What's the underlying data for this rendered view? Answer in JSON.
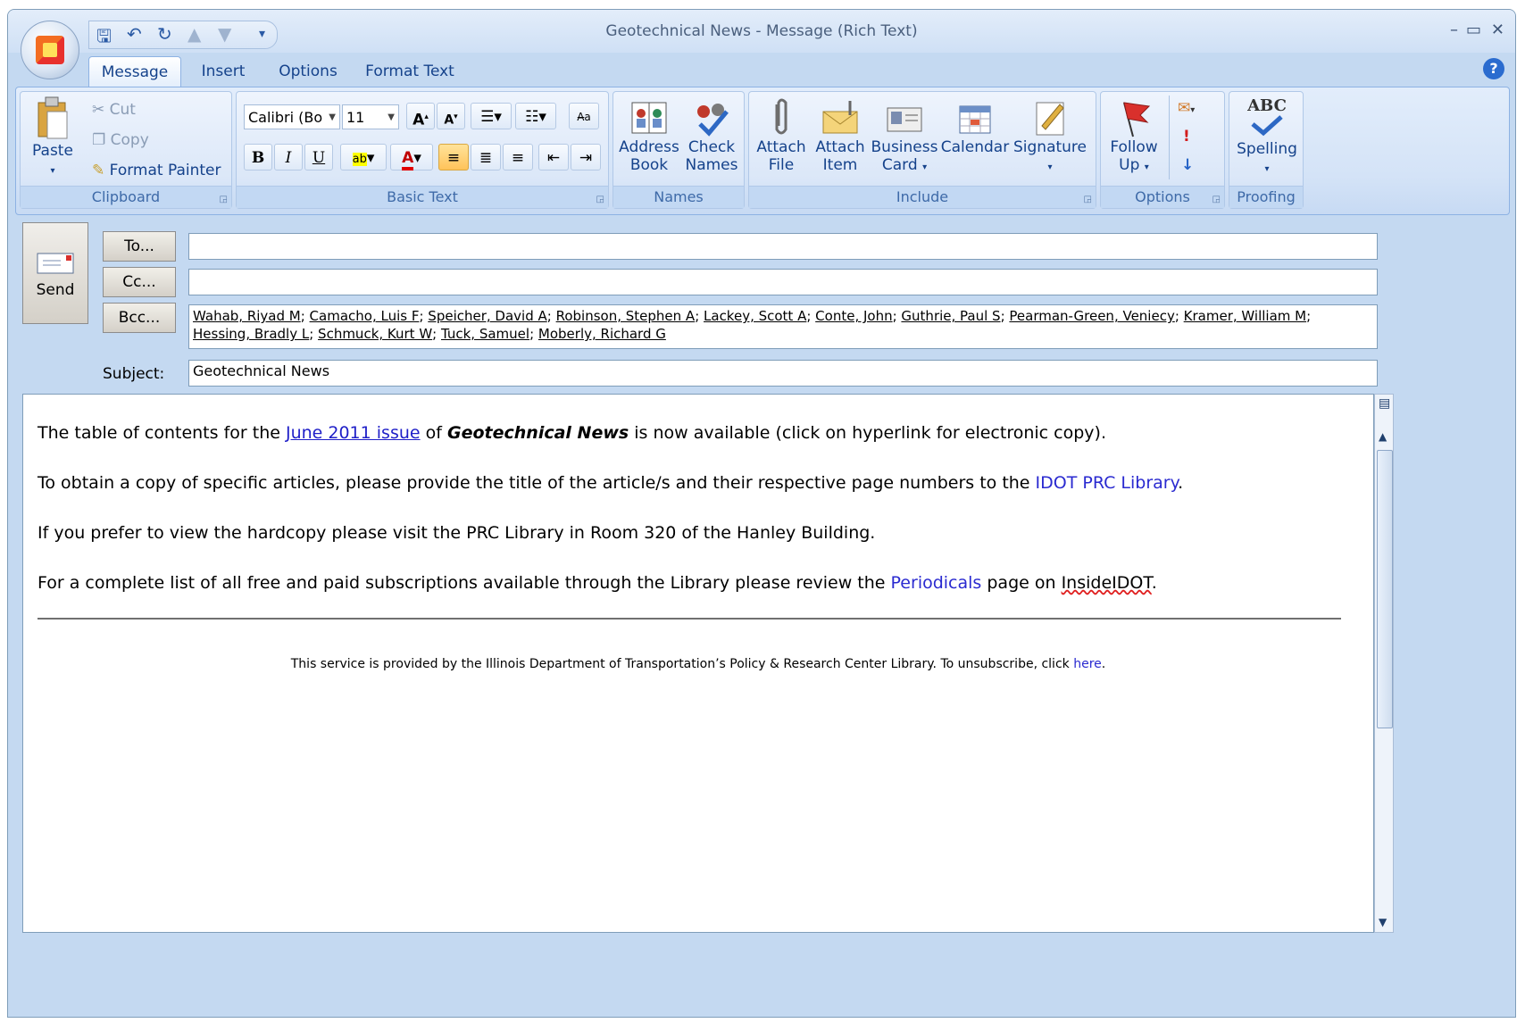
{
  "window": {
    "title": "Geotechnical News - Message (Rich Text)"
  },
  "quick_access": {
    "icons": [
      "save-icon",
      "undo-icon",
      "redo-icon",
      "up-arrow-icon",
      "down-arrow-icon",
      "customize-icon"
    ]
  },
  "tabs": [
    "Message",
    "Insert",
    "Options",
    "Format Text"
  ],
  "clipboard": {
    "paste": "Paste",
    "cut": "Cut",
    "copy": "Copy",
    "format_painter": "Format Painter",
    "label": "Clipboard"
  },
  "basic_text": {
    "font": "Calibri (Bo",
    "size": "11",
    "label": "Basic Text",
    "bold": "B",
    "italic": "I",
    "underline": "U"
  },
  "names": {
    "address_book_1": "Address",
    "address_book_2": "Book",
    "check_names_1": "Check",
    "check_names_2": "Names",
    "label": "Names"
  },
  "include": {
    "attach_file_1": "Attach",
    "attach_file_2": "File",
    "attach_item_1": "Attach",
    "attach_item_2": "Item",
    "business_card_1": "Business",
    "business_card_2": "Card",
    "calendar": "Calendar",
    "signature": "Signature",
    "label": "Include"
  },
  "options": {
    "follow_up_1": "Follow",
    "follow_up_2": "Up",
    "label": "Options"
  },
  "proofing": {
    "spelling": "Spelling",
    "abc": "ABC",
    "label": "Proofing"
  },
  "header": {
    "send": "Send",
    "to_btn": "To...",
    "cc_btn": "Cc...",
    "bcc_btn": "Bcc...",
    "to_value": "",
    "cc_value": "",
    "bcc_recipients": [
      "Wahab, Riyad M",
      "Camacho, Luis F",
      "Speicher, David A",
      "Robinson, Stephen A",
      "Lackey, Scott A",
      "Conte, John",
      "Guthrie, Paul S",
      "Pearman-Green, Veniecy",
      "Kramer, William M",
      "Hessing, Bradly L",
      "Schmuck, Kurt W",
      "Tuck, Samuel",
      "Moberly, Richard G"
    ],
    "subject_label": "Subject:",
    "subject_value": "Geotechnical News"
  },
  "body": {
    "p1_a": "The table of contents for the ",
    "p1_link": "June 2011 issue",
    "p1_b": " of ",
    "p1_bold": "Geotechnical News",
    "p1_c": " is now available (click on hyperlink for electronic copy).",
    "p2_a": "To obtain a copy of specific articles, please provide the title of the article/s and their respective page numbers to the ",
    "p2_link": "IDOT PRC Library",
    "p2_b": ".",
    "p3": "If you prefer to view the hardcopy please visit the PRC Library in Room 320 of the Hanley Building.",
    "p4_a": "For a complete list of all free and paid subscriptions available through the Library please review the ",
    "p4_link": "Periodicals",
    "p4_b": " page on ",
    "p4_c": "InsideIDOT",
    "p4_d": ".",
    "footer_a": "This service is provided by the Illinois Department of Transportation’s Policy & Research Center Library.  To unsubscribe, click ",
    "footer_link": "here",
    "footer_b": "."
  }
}
